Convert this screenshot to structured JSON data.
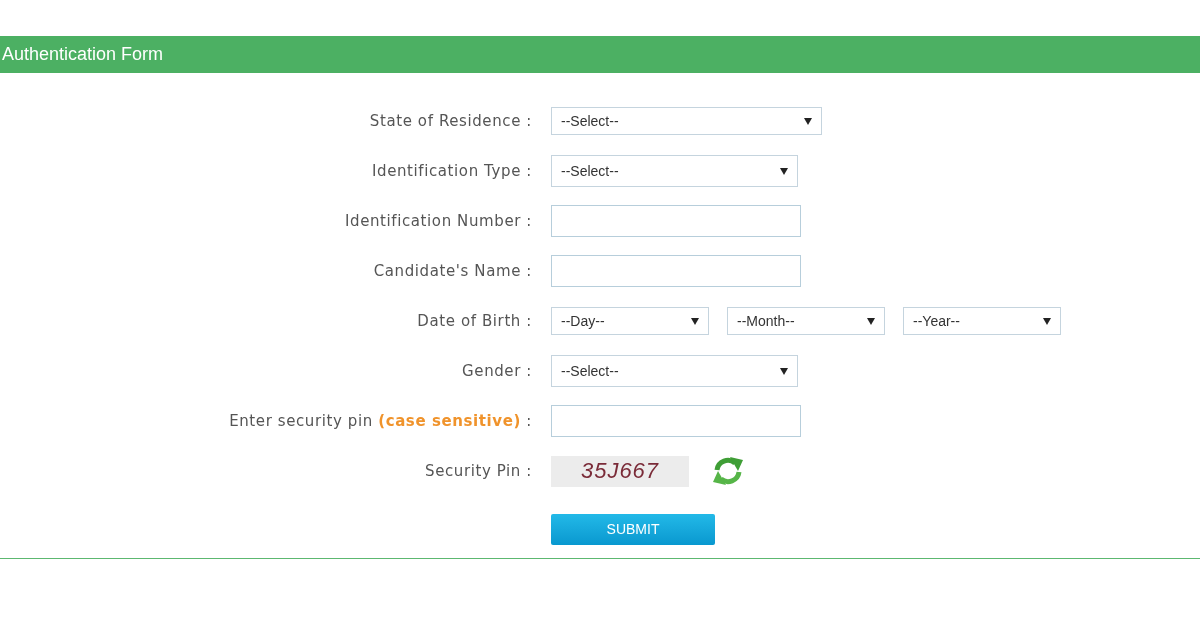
{
  "header": {
    "title": "Authentication Form"
  },
  "fields": [
    {
      "kind": "select",
      "label": "State of Residence :",
      "value": "--Select--"
    },
    {
      "kind": "select",
      "label": "Identification Type :",
      "value": "--Select--"
    },
    {
      "kind": "text",
      "label": "Identification Number :"
    },
    {
      "kind": "text",
      "label": "Candidate's Name :"
    },
    {
      "kind": "date",
      "label": "Date of Birth :",
      "parts": [
        {
          "value": "--Day--"
        },
        {
          "value": "--Month--"
        },
        {
          "value": "--Year--"
        }
      ]
    },
    {
      "kind": "select",
      "label": "Gender :",
      "value": "--Select--"
    },
    {
      "kind": "text",
      "label": "Enter security pin **(case sensitive)** :"
    },
    {
      "kind": "captcha",
      "label": "Security Pin :",
      "captcha_text": "35J667"
    }
  ],
  "submit": {
    "label": "SUBMIT"
  }
}
